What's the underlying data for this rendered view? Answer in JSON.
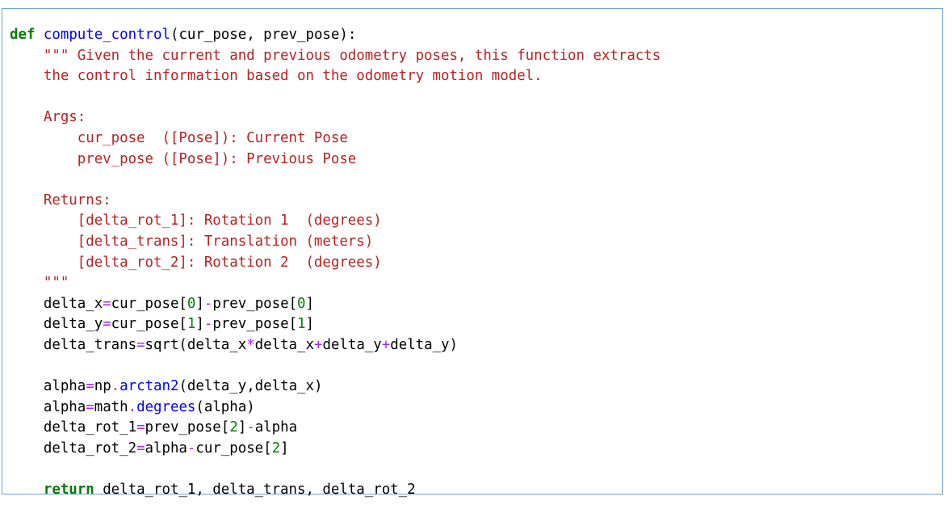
{
  "cell": {
    "lines": [
      [
        {
          "t": "def",
          "c": "kw"
        },
        {
          "t": " ",
          "c": ""
        },
        {
          "t": "compute_control",
          "c": "fn"
        },
        {
          "t": "(cur_pose, prev_pose):",
          "c": ""
        }
      ],
      [
        {
          "t": "    ",
          "c": ""
        },
        {
          "t": "\"\"\" Given the current and previous odometry poses, this function extracts",
          "c": "str"
        }
      ],
      [
        {
          "t": "    ",
          "c": ""
        },
        {
          "t": "the control information based on the odometry motion model.",
          "c": "str"
        }
      ],
      [
        {
          "t": "",
          "c": ""
        }
      ],
      [
        {
          "t": "    ",
          "c": ""
        },
        {
          "t": "Args:",
          "c": "str"
        }
      ],
      [
        {
          "t": "        ",
          "c": ""
        },
        {
          "t": "cur_pose  ([Pose]): Current Pose",
          "c": "str"
        }
      ],
      [
        {
          "t": "        ",
          "c": ""
        },
        {
          "t": "prev_pose ([Pose]): Previous Pose",
          "c": "str"
        }
      ],
      [
        {
          "t": "",
          "c": ""
        }
      ],
      [
        {
          "t": "    ",
          "c": ""
        },
        {
          "t": "Returns:",
          "c": "str"
        }
      ],
      [
        {
          "t": "        ",
          "c": ""
        },
        {
          "t": "[delta_rot_1]: Rotation 1  (degrees)",
          "c": "str"
        }
      ],
      [
        {
          "t": "        ",
          "c": ""
        },
        {
          "t": "[delta_trans]: Translation (meters)",
          "c": "str"
        }
      ],
      [
        {
          "t": "        ",
          "c": ""
        },
        {
          "t": "[delta_rot_2]: Rotation 2  (degrees)",
          "c": "str"
        }
      ],
      [
        {
          "t": "    ",
          "c": ""
        },
        {
          "t": "\"\"\"",
          "c": "str"
        }
      ],
      [
        {
          "t": "    delta_x",
          "c": ""
        },
        {
          "t": "=",
          "c": "op"
        },
        {
          "t": "cur_pose[",
          "c": ""
        },
        {
          "t": "0",
          "c": "num"
        },
        {
          "t": "]",
          "c": ""
        },
        {
          "t": "-",
          "c": "op"
        },
        {
          "t": "prev_pose[",
          "c": ""
        },
        {
          "t": "0",
          "c": "num"
        },
        {
          "t": "]",
          "c": ""
        }
      ],
      [
        {
          "t": "    delta_y",
          "c": ""
        },
        {
          "t": "=",
          "c": "op"
        },
        {
          "t": "cur_pose[",
          "c": ""
        },
        {
          "t": "1",
          "c": "num"
        },
        {
          "t": "]",
          "c": ""
        },
        {
          "t": "-",
          "c": "op"
        },
        {
          "t": "prev_pose[",
          "c": ""
        },
        {
          "t": "1",
          "c": "num"
        },
        {
          "t": "]",
          "c": ""
        }
      ],
      [
        {
          "t": "    delta_trans",
          "c": ""
        },
        {
          "t": "=",
          "c": "op"
        },
        {
          "t": "sqrt(delta_x",
          "c": ""
        },
        {
          "t": "*",
          "c": "op"
        },
        {
          "t": "delta_x",
          "c": ""
        },
        {
          "t": "+",
          "c": "op"
        },
        {
          "t": "delta_y",
          "c": ""
        },
        {
          "t": "+",
          "c": "op"
        },
        {
          "t": "delta_y)",
          "c": ""
        }
      ],
      [
        {
          "t": "",
          "c": ""
        }
      ],
      [
        {
          "t": "    alpha",
          "c": ""
        },
        {
          "t": "=",
          "c": "op"
        },
        {
          "t": "np",
          "c": ""
        },
        {
          "t": ".",
          "c": "op"
        },
        {
          "t": "arctan2",
          "c": "attr"
        },
        {
          "t": "(delta_y,delta_x)",
          "c": ""
        }
      ],
      [
        {
          "t": "    alpha",
          "c": ""
        },
        {
          "t": "=",
          "c": "op"
        },
        {
          "t": "math",
          "c": ""
        },
        {
          "t": ".",
          "c": "op"
        },
        {
          "t": "degrees",
          "c": "attr"
        },
        {
          "t": "(alpha)",
          "c": ""
        }
      ],
      [
        {
          "t": "    delta_rot_1",
          "c": ""
        },
        {
          "t": "=",
          "c": "op"
        },
        {
          "t": "prev_pose[",
          "c": ""
        },
        {
          "t": "2",
          "c": "num"
        },
        {
          "t": "]",
          "c": ""
        },
        {
          "t": "-",
          "c": "op"
        },
        {
          "t": "alpha",
          "c": ""
        }
      ],
      [
        {
          "t": "    delta_rot_2",
          "c": ""
        },
        {
          "t": "=",
          "c": "op"
        },
        {
          "t": "alpha",
          "c": ""
        },
        {
          "t": "-",
          "c": "op"
        },
        {
          "t": "cur_pose[",
          "c": ""
        },
        {
          "t": "2",
          "c": "num"
        },
        {
          "t": "]",
          "c": ""
        }
      ],
      [
        {
          "t": "",
          "c": ""
        }
      ],
      [
        {
          "t": "    ",
          "c": ""
        },
        {
          "t": "return",
          "c": "kw"
        },
        {
          "t": " delta_rot_1, delta_trans, delta_rot_2",
          "c": ""
        }
      ]
    ]
  }
}
